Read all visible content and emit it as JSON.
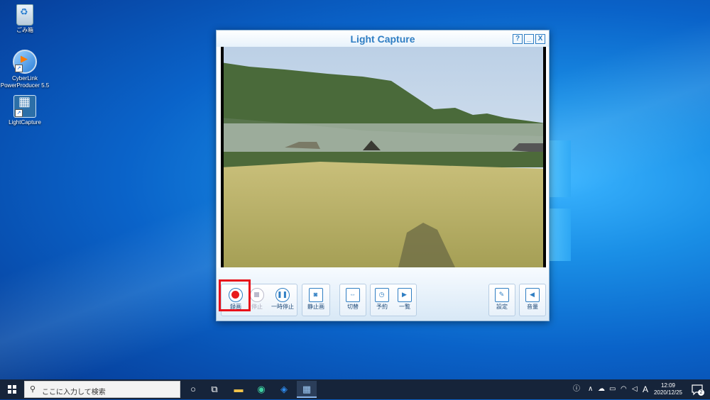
{
  "desktop": {
    "icons": [
      {
        "label": "ごみ箱",
        "icon": "recycle-bin-icon"
      },
      {
        "label": "CyberLink PowerProducer 5.5",
        "icon": "powerproducer-icon"
      },
      {
        "label": "LightCapture",
        "icon": "lightcapture-icon"
      }
    ]
  },
  "app": {
    "title": "Light Capture",
    "title_buttons": {
      "help": "?",
      "minimize": "_",
      "close": "X"
    },
    "controls": {
      "record": "録画",
      "stop": "停止",
      "pause": "一時停止",
      "snapshot": "静止画",
      "switch": "切替",
      "schedule": "予約",
      "list": "一覧",
      "settings": "設定",
      "volume": "音量"
    },
    "highlight_color": "#e8101a"
  },
  "taskbar": {
    "search_placeholder": "ここに入力して検索",
    "ime": "A",
    "time": "12:09",
    "date": "2020/12/25",
    "notification_count": "2"
  }
}
